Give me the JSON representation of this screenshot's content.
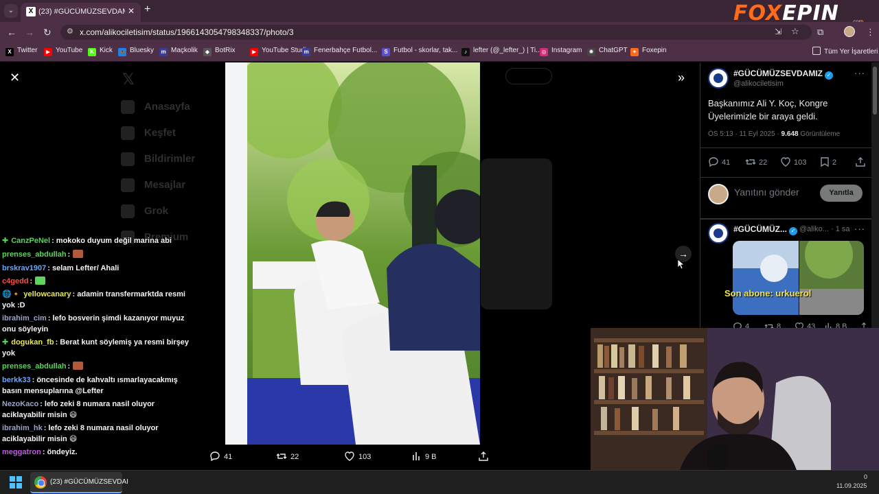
{
  "browser": {
    "tab_title": "(23) #GÜCÜMÜZSEVDAMIZ (@",
    "tab_favicon": "X",
    "url": "x.com/alikociletisim/status/1966143054798348337/photo/3",
    "bookmarks": [
      {
        "label": "Twitter",
        "icon_text": "X",
        "color": "#000000"
      },
      {
        "label": "YouTube",
        "icon_text": "▶",
        "color": "#ff0000"
      },
      {
        "label": "Kick",
        "icon_text": "K",
        "color": "#53fc18"
      },
      {
        "label": "Bluesky",
        "icon_text": "🦋",
        "color": "#1185fe"
      },
      {
        "label": "Maçkolik",
        "icon_text": "m",
        "color": "#3b3b9a"
      },
      {
        "label": "BotRix",
        "icon_text": "◆",
        "color": "#555555"
      },
      {
        "label": "YouTube Studio",
        "icon_text": "▶",
        "color": "#ff0000"
      },
      {
        "label": "Fenerbahçe Futbol...",
        "icon_text": "m",
        "color": "#3b3b9a"
      },
      {
        "label": "Futbol - skorlar, tak...",
        "icon_text": "S",
        "color": "#5a4fcf"
      },
      {
        "label": "lefter (@_lefter_) | Ti...",
        "icon_text": "♪",
        "color": "#111111"
      },
      {
        "label": "Instagram",
        "icon_text": "◎",
        "color": "#d62976"
      },
      {
        "label": "ChatGPT",
        "icon_text": "✺",
        "color": "#444444"
      },
      {
        "label": "Foxepin",
        "icon_text": "✦",
        "color": "#ff6b1a"
      }
    ],
    "all_bookmarks": "Tüm Yer İşaretleri"
  },
  "logo": {
    "prefix": "FOX",
    "suffix": "EPIN",
    "domain": ".com"
  },
  "viewer": {
    "stats": {
      "replies": "41",
      "reposts": "22",
      "likes": "103",
      "views": "9 B"
    }
  },
  "chat": [
    {
      "user": "CanzPeNel",
      "color": "#5bd45b",
      "text": ": mokoko duyum değil marina abi",
      "badge": "✚"
    },
    {
      "user": "prenses_abdullah",
      "color": "#5bd45b",
      "text": ":",
      "emote": "#b05a3c"
    },
    {
      "user": "brskrav1907",
      "color": "#6aa8ff",
      "text": ": selam Lefter/ Ahali"
    },
    {
      "user": "c4gedd",
      "color": "#ff4d4d",
      "text": ":",
      "emote": "#5ed45e"
    },
    {
      "user": "yellowcanary",
      "color": "#e8e85a",
      "text": ": adamin transfermarktda resmi yok :D",
      "badge": "🌐🔸"
    },
    {
      "user": "ibrahim_cim",
      "color": "#9aa4c8",
      "text": ": lefo bosverin şimdi kazanıyor muyuz onu söyleyin"
    },
    {
      "user": "dogukan_fb",
      "color": "#e8e85a",
      "text": ": Berat kunt söylemiş ya resmi birşey yok",
      "badge": "✚"
    },
    {
      "user": "prenses_abdullah",
      "color": "#5bd45b",
      "text": ":",
      "emote": "#b05a3c"
    },
    {
      "user": "berkk33",
      "color": "#6aa8ff",
      "text": ": öncesinde de kahvaltı ısmarlayacakmış basın mensuplarına @Lefter"
    },
    {
      "user": "NezoKaco",
      "color": "#9aa4c8",
      "text": ": lefo zeki 8 numara nasil oluyor aciklayabilir misin 😄"
    },
    {
      "user": "ibrahim_hk",
      "color": "#9aa4c8",
      "text": ": lefo zeki 8 numara nasil oluyor aciklayabilir misin 😄"
    },
    {
      "user": "meggatron",
      "color": "#c05ae0",
      "text": ": öndeyiz."
    }
  ],
  "ghost_nav": [
    "Anasayfa",
    "Keşfet",
    "Bildirimler",
    "Mesajlar",
    "Grok",
    "Premium"
  ],
  "tweet": {
    "name": "#GÜCÜMÜZSEVDAMIZ",
    "handle": "@alikociletisim",
    "text": "Başkanımız Ali Y. Koç, Kongre Üyelerimizle bir araya geldi.",
    "meta_prefix": "ÖS 5:13 · 11 Eyl 2025 · ",
    "meta_views": "9.648",
    "meta_suffix": " Görüntüleme",
    "stats": {
      "replies": "41",
      "reposts": "22",
      "likes": "103",
      "bookmarks": "2"
    },
    "reply_placeholder": "Yanıtını gönder",
    "reply_button": "Yanıtla"
  },
  "reply": {
    "name": "#GÜCÜMÜZ...",
    "handle_time": "@aliko... · 1 sa",
    "stats": {
      "replies": "4",
      "reposts": "8",
      "likes": "43",
      "views": "8 B"
    }
  },
  "overlay_text": "Son abone: urkuerol",
  "taskbar": {
    "app_label": "(23) #GÜCÜMÜZSEVDAI",
    "date": "11.09.2025",
    "time": "0"
  },
  "colors": {
    "accent_blue": "#1d9bf0",
    "chrome_bg": "#4d2f46",
    "orange_brand": "#ff6b1a"
  }
}
